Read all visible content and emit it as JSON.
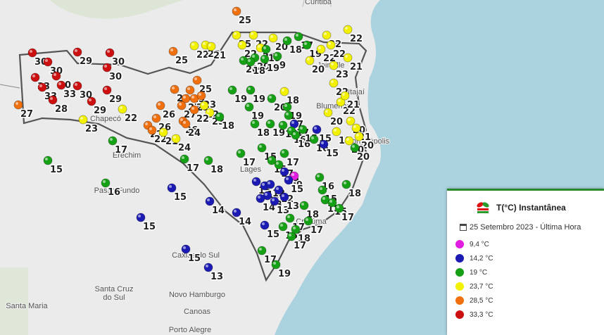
{
  "legend": {
    "title": "T(°C) Instantânea",
    "logo_text": "Epagri",
    "date_label": "25 Setembro 2023 - Última Hora",
    "items": [
      {
        "label": "9,4 °C",
        "color": "#e21de2"
      },
      {
        "label": "14,2 °C",
        "color": "#1b1bb3"
      },
      {
        "label": "19 °C",
        "color": "#16a016"
      },
      {
        "label": "23,7 °C",
        "color": "#f2f200"
      },
      {
        "label": "28,5 °C",
        "color": "#f07010"
      },
      {
        "label": "33,3 °C",
        "color": "#cc1010"
      }
    ]
  },
  "places": [
    "Curitiba",
    "Joinville",
    "Itajaí",
    "Blumenau",
    "Florianópolis",
    "Chapecó",
    "Erechim",
    "Lages",
    "Passo Fundo",
    "Criciúma",
    "Caxias do Sul",
    "Santa Cruz do Sul",
    "Novo Hamburgo",
    "Canoas",
    "Porto Alegre",
    "Santa Maria"
  ],
  "stations": [
    [
      336,
      16,
      25,
      "o"
    ],
    [
      46,
      75,
      30,
      "r"
    ],
    [
      110,
      74,
      29,
      "r"
    ],
    [
      156,
      75,
      30,
      "r"
    ],
    [
      68,
      88,
      30,
      "r"
    ],
    [
      50,
      110,
      33,
      "r"
    ],
    [
      80,
      108,
      30,
      "r"
    ],
    [
      60,
      124,
      33,
      "r"
    ],
    [
      87,
      121,
      33,
      "r"
    ],
    [
      152,
      96,
      30,
      "r"
    ],
    [
      110,
      122,
      30,
      "r"
    ],
    [
      152,
      128,
      29,
      "r"
    ],
    [
      75,
      142,
      28,
      "r"
    ],
    [
      130,
      144,
      29,
      "r"
    ],
    [
      26,
      149,
      27,
      "o"
    ],
    [
      118,
      170,
      23,
      "y"
    ],
    [
      174,
      155,
      22,
      "y"
    ],
    [
      246,
      73,
      25,
      "o"
    ],
    [
      276,
      65,
      22,
      "y"
    ],
    [
      292,
      64,
      22,
      "y"
    ],
    [
      300,
      66,
      21,
      "y"
    ],
    [
      336,
      50,
      25,
      "y"
    ],
    [
      344,
      64,
      22,
      "y"
    ],
    [
      360,
      50,
      22,
      "y"
    ],
    [
      370,
      68,
      22,
      "y"
    ],
    [
      388,
      54,
      20,
      "y"
    ],
    [
      378,
      70,
      19,
      "g"
    ],
    [
      408,
      58,
      18,
      "g"
    ],
    [
      424,
      52,
      17,
      "g"
    ],
    [
      436,
      64,
      19,
      "g"
    ],
    [
      346,
      86,
      20,
      "g"
    ],
    [
      362,
      82,
      20,
      "g"
    ],
    [
      376,
      84,
      19,
      "g"
    ],
    [
      394,
      80,
      9,
      "g"
    ],
    [
      356,
      88,
      18,
      "g"
    ],
    [
      440,
      86,
      20,
      "y"
    ],
    [
      456,
      70,
      22,
      "y"
    ],
    [
      464,
      50,
      22,
      "y"
    ],
    [
      494,
      42,
      22,
      "y"
    ],
    [
      470,
      64,
      22,
      "y"
    ],
    [
      494,
      82,
      21,
      "y"
    ],
    [
      474,
      93,
      23,
      "y"
    ],
    [
      474,
      118,
      22,
      "y"
    ],
    [
      484,
      145,
      22,
      "y"
    ],
    [
      490,
      136,
      21,
      "y"
    ],
    [
      466,
      160,
      20,
      "y"
    ],
    [
      498,
      172,
      20,
      "y"
    ],
    [
      506,
      182,
      21,
      "y"
    ],
    [
      510,
      194,
      20,
      "y"
    ],
    [
      478,
      187,
      19,
      "y"
    ],
    [
      496,
      200,
      20,
      "y"
    ],
    [
      504,
      210,
      20,
      "g"
    ],
    [
      280,
      114,
      25,
      "o"
    ],
    [
      248,
      127,
      28,
      "o"
    ],
    [
      270,
      128,
      25,
      "o"
    ],
    [
      264,
      140,
      27,
      "o"
    ],
    [
      258,
      150,
      27,
      "o"
    ],
    [
      276,
      140,
      25,
      "o"
    ],
    [
      286,
      136,
      23,
      "o"
    ],
    [
      290,
      150,
      22,
      "y"
    ],
    [
      228,
      150,
      26,
      "o"
    ],
    [
      298,
      160,
      23,
      "y"
    ],
    [
      276,
      156,
      22,
      "o"
    ],
    [
      260,
      172,
      26,
      "o"
    ],
    [
      264,
      176,
      24,
      "o"
    ],
    [
      222,
      168,
      26,
      "o"
    ],
    [
      210,
      178,
      22,
      "o"
    ],
    [
      216,
      185,
      22,
      "o"
    ],
    [
      232,
      188,
      21,
      "y"
    ],
    [
      250,
      197,
      24,
      "y"
    ],
    [
      312,
      166,
      18,
      "g"
    ],
    [
      330,
      128,
      19,
      "g"
    ],
    [
      356,
      128,
      19,
      "g"
    ],
    [
      386,
      140,
      20,
      "g"
    ],
    [
      404,
      130,
      18,
      "y"
    ],
    [
      354,
      152,
      19,
      "g"
    ],
    [
      408,
      152,
      19,
      "g"
    ],
    [
      362,
      176,
      18,
      "g"
    ],
    [
      410,
      164,
      17,
      "g"
    ],
    [
      384,
      176,
      19,
      "g"
    ],
    [
      402,
      178,
      15,
      "g"
    ],
    [
      418,
      176,
      17,
      "b"
    ],
    [
      414,
      186,
      16,
      "g"
    ],
    [
      420,
      192,
      16,
      "g"
    ],
    [
      430,
      184,
      15,
      "g"
    ],
    [
      450,
      184,
      15,
      "b"
    ],
    [
      446,
      198,
      16,
      "g"
    ],
    [
      372,
      210,
      15,
      "g"
    ],
    [
      404,
      218,
      17,
      "g"
    ],
    [
      460,
      205,
      15,
      "b"
    ],
    [
      160,
      200,
      17,
      "g"
    ],
    [
      68,
      228,
      15,
      "g"
    ],
    [
      262,
      226,
      17,
      "g"
    ],
    [
      296,
      228,
      18,
      "g"
    ],
    [
      342,
      218,
      17,
      "g"
    ],
    [
      386,
      228,
      15,
      "g"
    ],
    [
      396,
      234,
      17,
      "g"
    ],
    [
      404,
      244,
      19,
      "b"
    ],
    [
      418,
      250,
      9,
      "m"
    ],
    [
      410,
      256,
      15,
      "b"
    ],
    [
      454,
      252,
      16,
      "g"
    ],
    [
      492,
      262,
      18,
      "g"
    ],
    [
      364,
      258,
      15,
      "b"
    ],
    [
      376,
      264,
      12,
      "b"
    ],
    [
      384,
      262,
      12,
      "b"
    ],
    [
      380,
      278,
      13,
      "b"
    ],
    [
      396,
      270,
      12,
      "b"
    ],
    [
      370,
      282,
      14,
      "b"
    ],
    [
      390,
      286,
      13,
      "b"
    ],
    [
      404,
      280,
      13,
      "b"
    ],
    [
      458,
      270,
      15,
      "g"
    ],
    [
      462,
      284,
      18,
      "g"
    ],
    [
      472,
      288,
      15,
      "g"
    ],
    [
      482,
      296,
      17,
      "g"
    ],
    [
      150,
      260,
      16,
      "g"
    ],
    [
      244,
      267,
      15,
      "b"
    ],
    [
      298,
      286,
      14,
      "b"
    ],
    [
      432,
      292,
      18,
      "g"
    ],
    [
      336,
      302,
      14,
      "b"
    ],
    [
      200,
      309,
      15,
      "b"
    ],
    [
      412,
      310,
      17,
      "g"
    ],
    [
      438,
      314,
      17,
      "g"
    ],
    [
      376,
      320,
      15,
      "b"
    ],
    [
      402,
      322,
      15,
      "g"
    ],
    [
      420,
      326,
      18,
      "g"
    ],
    [
      414,
      336,
      17,
      "g"
    ],
    [
      264,
      354,
      15,
      "b"
    ],
    [
      372,
      356,
      17,
      "g"
    ],
    [
      296,
      380,
      13,
      "b"
    ],
    [
      392,
      376,
      19,
      "g"
    ]
  ]
}
